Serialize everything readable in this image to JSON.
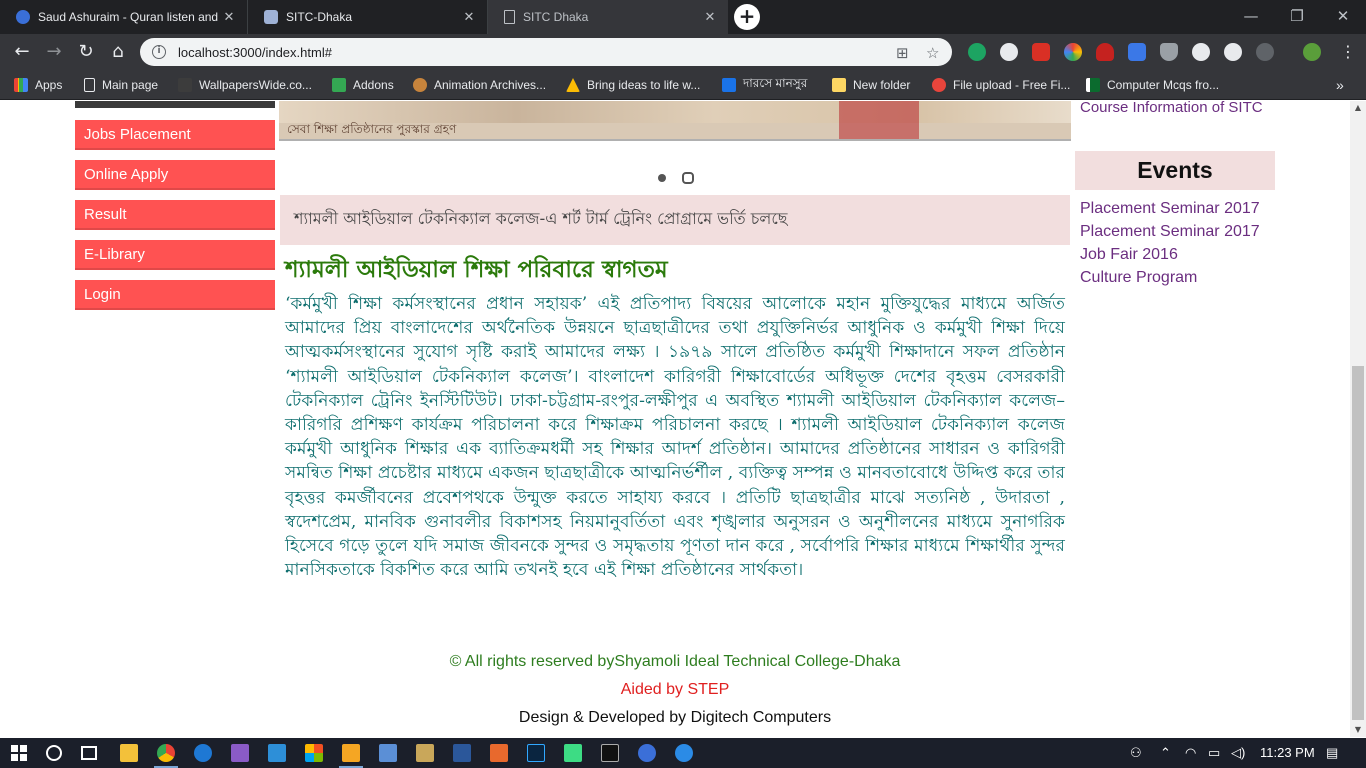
{
  "browser": {
    "tabs": [
      {
        "title": "Saud Ashuraim - Quran listen and",
        "icon": "quran-site-icon",
        "active": false
      },
      {
        "title": "SITC-Dhaka",
        "icon": "sitc-favicon-icon",
        "active": false
      },
      {
        "title": "SITC Dhaka",
        "icon": "page-icon",
        "active": true
      }
    ],
    "url": "localhost:3000/index.html#",
    "bookmarks": [
      {
        "label": "Apps",
        "icon": "apps-grid-icon"
      },
      {
        "label": "Main page",
        "icon": "page-icon"
      },
      {
        "label": "WallpapersWide.co...",
        "icon": "wallpaper-icon"
      },
      {
        "label": "Addons",
        "icon": "puzzle-icon"
      },
      {
        "label": "Animation Archives...",
        "icon": "animation-icon"
      },
      {
        "label": "Bring ideas to life w...",
        "icon": "ideas-icon"
      },
      {
        "label": "দারসে মানসুর",
        "icon": "book-icon"
      },
      {
        "label": "New folder",
        "icon": "folder-icon"
      },
      {
        "label": "File upload - Free Fi...",
        "icon": "upload-icon"
      },
      {
        "label": "Computer Mcqs fro...",
        "icon": "flag-icon"
      }
    ],
    "window_controls": [
      "minimize",
      "maximize",
      "close"
    ]
  },
  "page": {
    "sidebar_menu": [
      "Jobs Placement",
      "Online Apply",
      "Result",
      "E-Library",
      "Login"
    ],
    "slider_caption": "সেবা শিক্ষা প্রতিষ্ঠানের পুরস্কার গ্রহণ",
    "notice": "শ্যামলী আইডিয়াল টেকনিক্যাল কলেজ-এ শর্ট টার্ম ট্রেনিং প্রোগ্রামে ভর্তি চলছে",
    "welcome_title": "শ্যামলী আইডিয়াল শিক্ষা পরিবারে স্বাগতম",
    "welcome_body": "‘কর্মমুখী শিক্ষা কর্মসংস্থানের প্রধান সহায়ক’ এই প্রতিপাদ্য বিষয়ের আলোকে মহান মুক্তিযুদ্ধের মাধ্যমে অর্জিত আমাদের প্রিয় বাংলাদেশের অর্থনৈতিক উন্নয়নে ছাত্রছাত্রীদের তথা প্রযুক্তিনির্ভর আধুনিক ও কর্মমুখী শিক্ষা দিয়ে আত্মকর্মসংস্থানের সুযোগ সৃষ্টি করাই আমাদের লক্ষ্য । ১৯৭৯ সালে প্রতিষ্ঠিত কর্মমুখী শিক্ষাদানে সফল প্রতিষ্ঠান ‘শ্যামলী আইডিয়াল টেকনিক্যাল কলেজ’। বাংলাদেশ কারিগরী শিক্ষাবোর্ডের অধিভূক্ত দেশের বৃহত্তম বেসরকারী টেকনিক্যাল ট্রেনিং ইনস্টিটিউট। ঢাকা-চট্টগ্রাম-রংপুর-লক্ষীপুর এ অবস্থিত শ্যামলী আইডিয়াল টেকনিক্যাল কলেজ– কারিগরি প্রশিক্ষণ কার্যক্রম পরিচালনা করে শিক্ষাক্রম পরিচালনা করছে । শ্যামলী আইডিয়াল টেকনিক্যাল কলেজ কর্মমুখী আধুনিক শিক্ষার এক ব্যাতিক্রমধর্মী সহ শিক্ষার আদর্শ প্রতিষ্ঠান। আমাদের প্রতিষ্ঠানের সাধারন ও কারিগরী সমন্বিত শিক্ষা প্রচেষ্টার মাধ্যমে একজন ছাত্রছাত্রীকে আত্মনির্ভর্শীল , ব্যক্তিত্ব সম্পন্ন ও মানবতাবোধে উদ্দিপ্ত করে তার বৃহত্তর কমর্জীবনের প্রবেশপথকে উন্মুক্ত করতে সাহায্য করবে । প্রতিটি ছাত্রছাত্রীর মাঝে সত্যনিষ্ঠ , উদারতা , স্বদেশপ্রেম, মানবিক গুনাবলীর বিকাশসহ নিয়মানুবর্তিতা এবং শৃঙ্খলার অনুসরন ও অনুশীলনের মাধ্যমে সুনাগরিক হিসেবে গড়ে তুলে যদি সমাজ জীবনকে সুন্দর ও সমৃদ্ধতায় পূণতা দান করে , সর্বোপরি শিক্ষার মাধ্যমে শিক্ষার্থীর সুন্দর মানসিকতাকে বিকশিত করে আমি তখনই হবে এই শিক্ষা প্রতিষ্ঠানের সার্থকতা।",
    "course_link": "Course Information of SITC",
    "events_heading": "Events",
    "events": [
      "Placement Seminar 2017",
      "Placement Seminar 2017",
      "Job Fair 2016",
      "Culture Program"
    ],
    "footer": {
      "copyright": "© All rights reserved byShyamoli Ideal Technical College-Dhaka",
      "aided": "Aided by STEP",
      "developer": "Design & Developed by Digitech Computers"
    }
  },
  "taskbar": {
    "clock": "11:23 PM"
  },
  "colors": {
    "menu_red": "#ff5252",
    "notice_bg": "#f2dede",
    "welcome_green": "#2b7a0b",
    "body_teal": "#0e6e6e",
    "link_purple": "#6b2e80",
    "footer_green": "#2e7d1f",
    "footer_red": "#e02020"
  }
}
